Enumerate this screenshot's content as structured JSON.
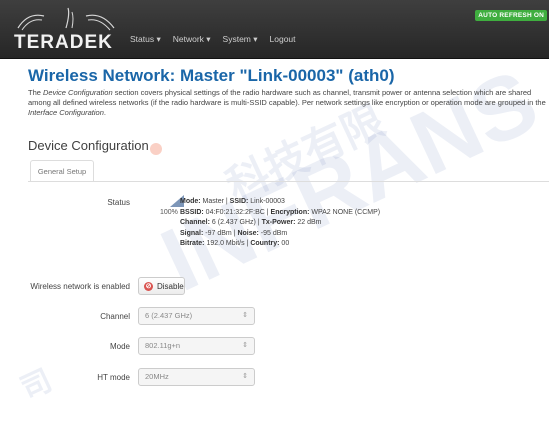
{
  "header": {
    "brand": "TERADEK",
    "nav": [
      "Status ▾",
      "Network ▾",
      "System ▾",
      "Logout"
    ],
    "auto_refresh": "AUTO REFRESH ON"
  },
  "page": {
    "title": "Wireless Network: Master \"Link-00003\" (ath0)",
    "desc_prefix": "The ",
    "desc_em1": "Device Configuration",
    "desc_mid": " section covers physical settings of the radio hardware such as channel, transmit power or antenna selection which are shared among all defined wireless networks (if the radio hardware is multi-SSID capable). Per network settings like encryption or operation mode are grouped in the ",
    "desc_em2": "Interface Configuration",
    "desc_suffix": "."
  },
  "device_config": {
    "title": "Device Configuration",
    "tab": "General Setup",
    "status": {
      "label": "Status",
      "percent": "100%",
      "mode_label": "Mode:",
      "mode_value": " Master | ",
      "ssid_label": "SSID:",
      "ssid_value": " Link-00003",
      "bssid_label": "BSSID:",
      "bssid_value": " 04:F0:21:32:2F:BC | ",
      "encryption_label": "Encryption:",
      "encryption_value": " WPA2 NONE (CCMP)",
      "channel_label": "Channel:",
      "channel_value": " 6 (2.437 GHz) | ",
      "txpower_label": "Tx-Power:",
      "txpower_value": " 22 dBm",
      "signal_label": "Signal:",
      "signal_value": " -97 dBm | ",
      "noise_label": "Noise:",
      "noise_value": " -95 dBm",
      "bitrate_label": "Bitrate:",
      "bitrate_value": " 192.0 Mbit/s | ",
      "country_label": "Country:",
      "country_value": " 00"
    },
    "enabled_label": "Wireless network is enabled",
    "disable_button": "Disable",
    "channel_label": "Channel",
    "channel_value": "6 (2.437 GHz)",
    "mode_label": "Mode",
    "mode_value": "802.11g+n",
    "htmode_label": "HT mode",
    "htmode_value": "20MHz",
    "select_caret": "⇕"
  },
  "watermark": {
    "text1": "INFRANS",
    "text2": "科技有限",
    "text3": "司"
  }
}
